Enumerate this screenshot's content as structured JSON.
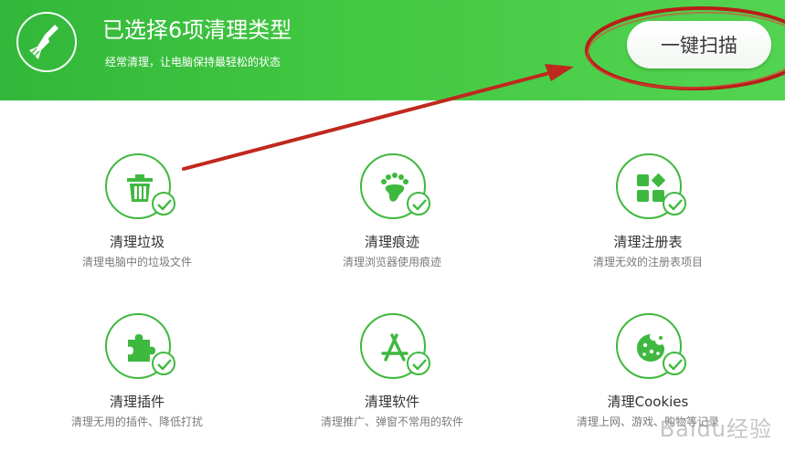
{
  "header": {
    "title": "已选择6项清理类型",
    "subtitle": "经常清理，让电脑保持最轻松的状态",
    "scan_button": "一键扫描",
    "logo_icon": "broom-icon"
  },
  "items": [
    {
      "name": "清理垃圾",
      "desc": "清理电脑中的垃圾文件",
      "icon": "trash-icon",
      "checked": true
    },
    {
      "name": "清理痕迹",
      "desc": "清理浏览器使用痕迹",
      "icon": "footprint-icon",
      "checked": true
    },
    {
      "name": "清理注册表",
      "desc": "清理无效的注册表项目",
      "icon": "registry-blocks-icon",
      "checked": true
    },
    {
      "name": "清理插件",
      "desc": "清理无用的插件、降低打扰",
      "icon": "puzzle-icon",
      "checked": true
    },
    {
      "name": "清理软件",
      "desc": "清理推广、弹窗不常用的软件",
      "icon": "app-store-icon",
      "checked": true
    },
    {
      "name": "清理Cookies",
      "desc": "清理上网、游戏、购物等记录",
      "icon": "cookie-icon",
      "checked": true
    }
  ],
  "watermark": "Baidu经验",
  "colors": {
    "brand_green": "#43c842",
    "icon_green": "#3fb83f",
    "annotation_red": "#c0281e"
  }
}
